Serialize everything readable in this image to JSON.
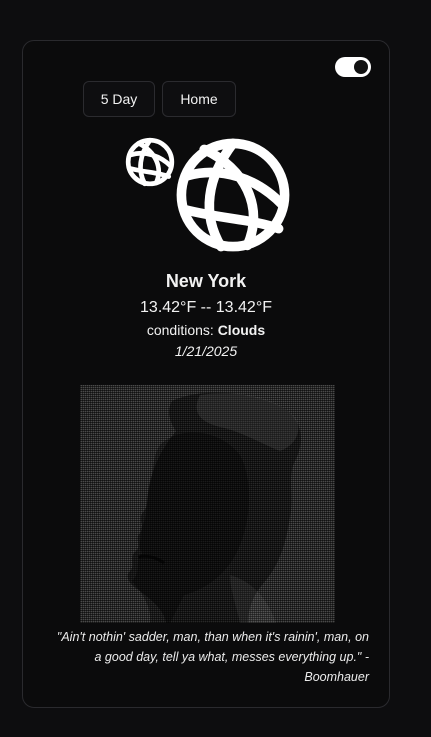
{
  "toggle": {
    "state": "on"
  },
  "nav": {
    "five_day_label": "5 Day",
    "home_label": "Home"
  },
  "icons": {
    "small": "globe-icon",
    "large": "globe-icon"
  },
  "weather": {
    "city": "New York",
    "temperature": "13.42°F -- 13.42°F",
    "conditions_prefix": "conditions: ",
    "conditions_value": "Clouds",
    "date": "1/21/2025"
  },
  "quote": {
    "text": "\"Ain't nothin' sadder, man, than when it's rainin', man, on a good day, tell ya what, messes everything up.\" - Boomhauer"
  },
  "colors": {
    "background": "#0d0d0f",
    "card_border": "#2a2a2e",
    "text": "#f2f2f2"
  }
}
